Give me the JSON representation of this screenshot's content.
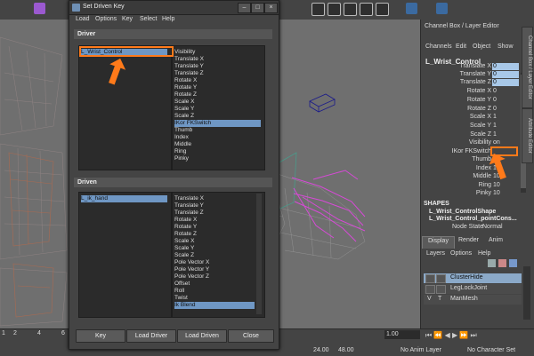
{
  "colors": {
    "accent_orange": "#ff7a1a",
    "selection_blue": "#6f97c4",
    "channel_highlight": "#a8c8e8",
    "wireframe_magenta": "#d64ad6"
  },
  "dialog": {
    "title": "Set Driven Key",
    "menu": [
      "Load",
      "Options",
      "Key",
      "Select",
      "Help"
    ],
    "driver": {
      "header": "Driver",
      "object": "L_Wrist_Control",
      "attributes": [
        "Visibility",
        "Translate X",
        "Translate Y",
        "Translate Z",
        "Rotate X",
        "Rotate Y",
        "Rotate Z",
        "Scale X",
        "Scale Y",
        "Scale Z",
        "IKor FKSwitch",
        "Thumb",
        "Index",
        "Middle",
        "Ring",
        "Pinky"
      ],
      "selected_attribute": "IKor FKSwitch"
    },
    "driven": {
      "header": "Driven",
      "object": "L_ik_hand",
      "attributes": [
        "Translate X",
        "Translate Y",
        "Translate Z",
        "Rotate X",
        "Rotate Y",
        "Rotate Z",
        "Scale X",
        "Scale Y",
        "Scale Z",
        "Pole Vector X",
        "Pole Vector Y",
        "Pole Vector Z",
        "Offset",
        "Roll",
        "Twist",
        "Ik Blend"
      ],
      "selected_attribute": "Ik Blend"
    },
    "buttons": {
      "key": "Key",
      "load_driver": "Load Driver",
      "load_driven": "Load Driven",
      "close": "Close"
    }
  },
  "channel_box": {
    "title": "Channel Box / Layer Editor",
    "menu": [
      "Channels",
      "Edit",
      "Object",
      "Show"
    ],
    "object_name": "L_Wrist_Control",
    "attributes": [
      {
        "name": "Translate X",
        "value": "0"
      },
      {
        "name": "Translate Y",
        "value": "0"
      },
      {
        "name": "Translate Z",
        "value": "0"
      },
      {
        "name": "Rotate X",
        "value": "0"
      },
      {
        "name": "Rotate Y",
        "value": "0"
      },
      {
        "name": "Rotate Z",
        "value": "0"
      },
      {
        "name": "Scale X",
        "value": "1"
      },
      {
        "name": "Scale Y",
        "value": "1"
      },
      {
        "name": "Scale Z",
        "value": "1"
      },
      {
        "name": "Visibility",
        "value": "on"
      },
      {
        "name": "IKor FKSwitch",
        "value": ""
      },
      {
        "name": "Thumb",
        "value": "10"
      },
      {
        "name": "Index",
        "value": "10"
      },
      {
        "name": "Middle",
        "value": "10"
      },
      {
        "name": "Ring",
        "value": "10"
      },
      {
        "name": "Pinky",
        "value": "10"
      }
    ],
    "shapes_header": "SHAPES",
    "shapes": [
      "L_Wrist_ControlShape",
      "L_Wrist_Control_pointCons..."
    ],
    "node_state_label": "Node State",
    "node_state_value": "Normal",
    "side_tabs": [
      "Channel Box / Layer Editor",
      "Attribute Editor"
    ]
  },
  "layer_editor": {
    "tabs": [
      "Display",
      "Render",
      "Anim"
    ],
    "menu": [
      "Layers",
      "Options",
      "Help"
    ],
    "layers": [
      {
        "v": "",
        "t": "",
        "name": "ClusterHide"
      },
      {
        "v": "",
        "t": "",
        "name": "LegLockJoint"
      },
      {
        "v": "V",
        "t": "T",
        "name": "ManMesh"
      }
    ]
  },
  "timeline": {
    "frame_ticks": [
      "1",
      "2",
      "4",
      "6",
      "8"
    ],
    "range_end_field": "1.00",
    "start_frame": "24.00",
    "end_frame": "48.00",
    "anim_layer": "No Anim Layer",
    "character_set": "No Character Set"
  }
}
